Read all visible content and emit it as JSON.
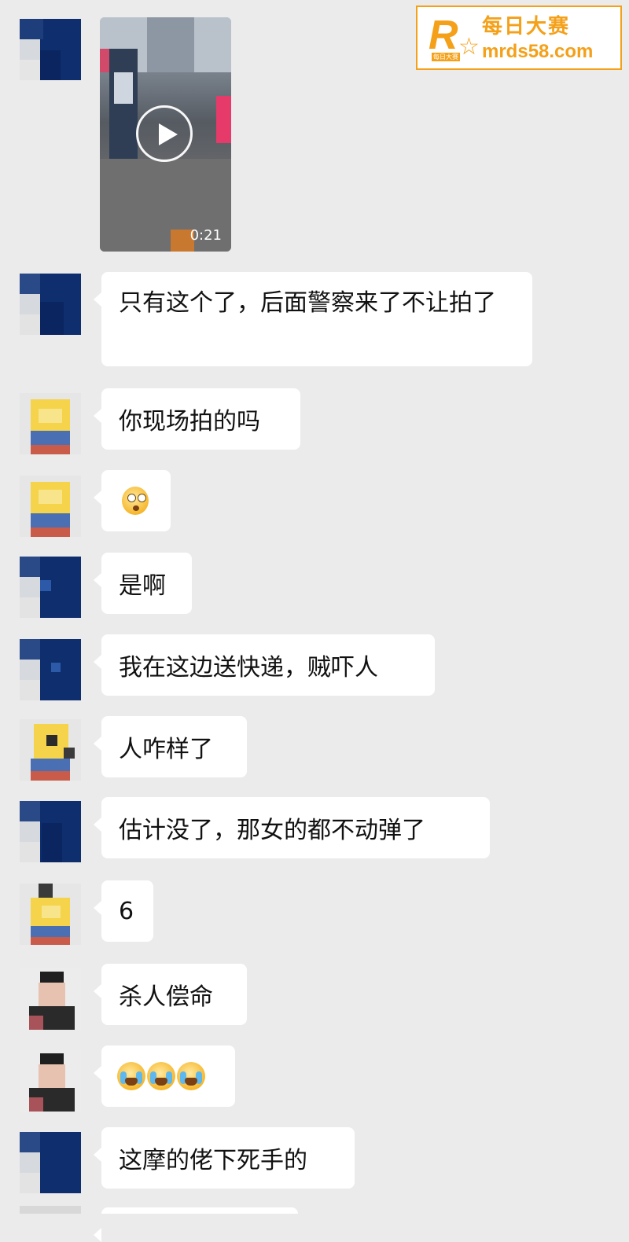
{
  "watermark": {
    "brand_letter": "R",
    "brand_small": "每日大赛",
    "name": "每日大赛",
    "url": "mrds58.com",
    "color": "#f4a019"
  },
  "video": {
    "duration": "0:21",
    "play_icon": "play-icon"
  },
  "messages": [
    {
      "sender": "avatar-navy",
      "type": "text",
      "text": "只有这个了，后面警察来了不让拍了"
    },
    {
      "sender": "avatar-yellow",
      "type": "text",
      "text": "你现场拍的吗"
    },
    {
      "sender": "avatar-yellow",
      "type": "emoji",
      "emoji": [
        "shocked-face-icon"
      ]
    },
    {
      "sender": "avatar-navy",
      "type": "text",
      "text": "是啊"
    },
    {
      "sender": "avatar-navy",
      "type": "text",
      "text": "我在这边送快递，贼吓人"
    },
    {
      "sender": "avatar-yellow",
      "type": "text",
      "text": "人咋样了"
    },
    {
      "sender": "avatar-navy",
      "type": "text",
      "text": "估计没了，那女的都不动弹了"
    },
    {
      "sender": "avatar-yellow",
      "type": "text",
      "text": "6"
    },
    {
      "sender": "avatar-person",
      "type": "text",
      "text": "杀人偿命"
    },
    {
      "sender": "avatar-person",
      "type": "emoji",
      "emoji": [
        "facepalm-cry-icon",
        "facepalm-cry-icon",
        "facepalm-cry-icon"
      ]
    },
    {
      "sender": "avatar-navy",
      "type": "text",
      "text": "这摩的佬下死手的"
    }
  ],
  "colors": {
    "background": "#ebebeb",
    "bubble": "#ffffff",
    "text": "#111111",
    "avatar_navy": "#0e2e6e",
    "avatar_yellow": "#f5d34a"
  }
}
